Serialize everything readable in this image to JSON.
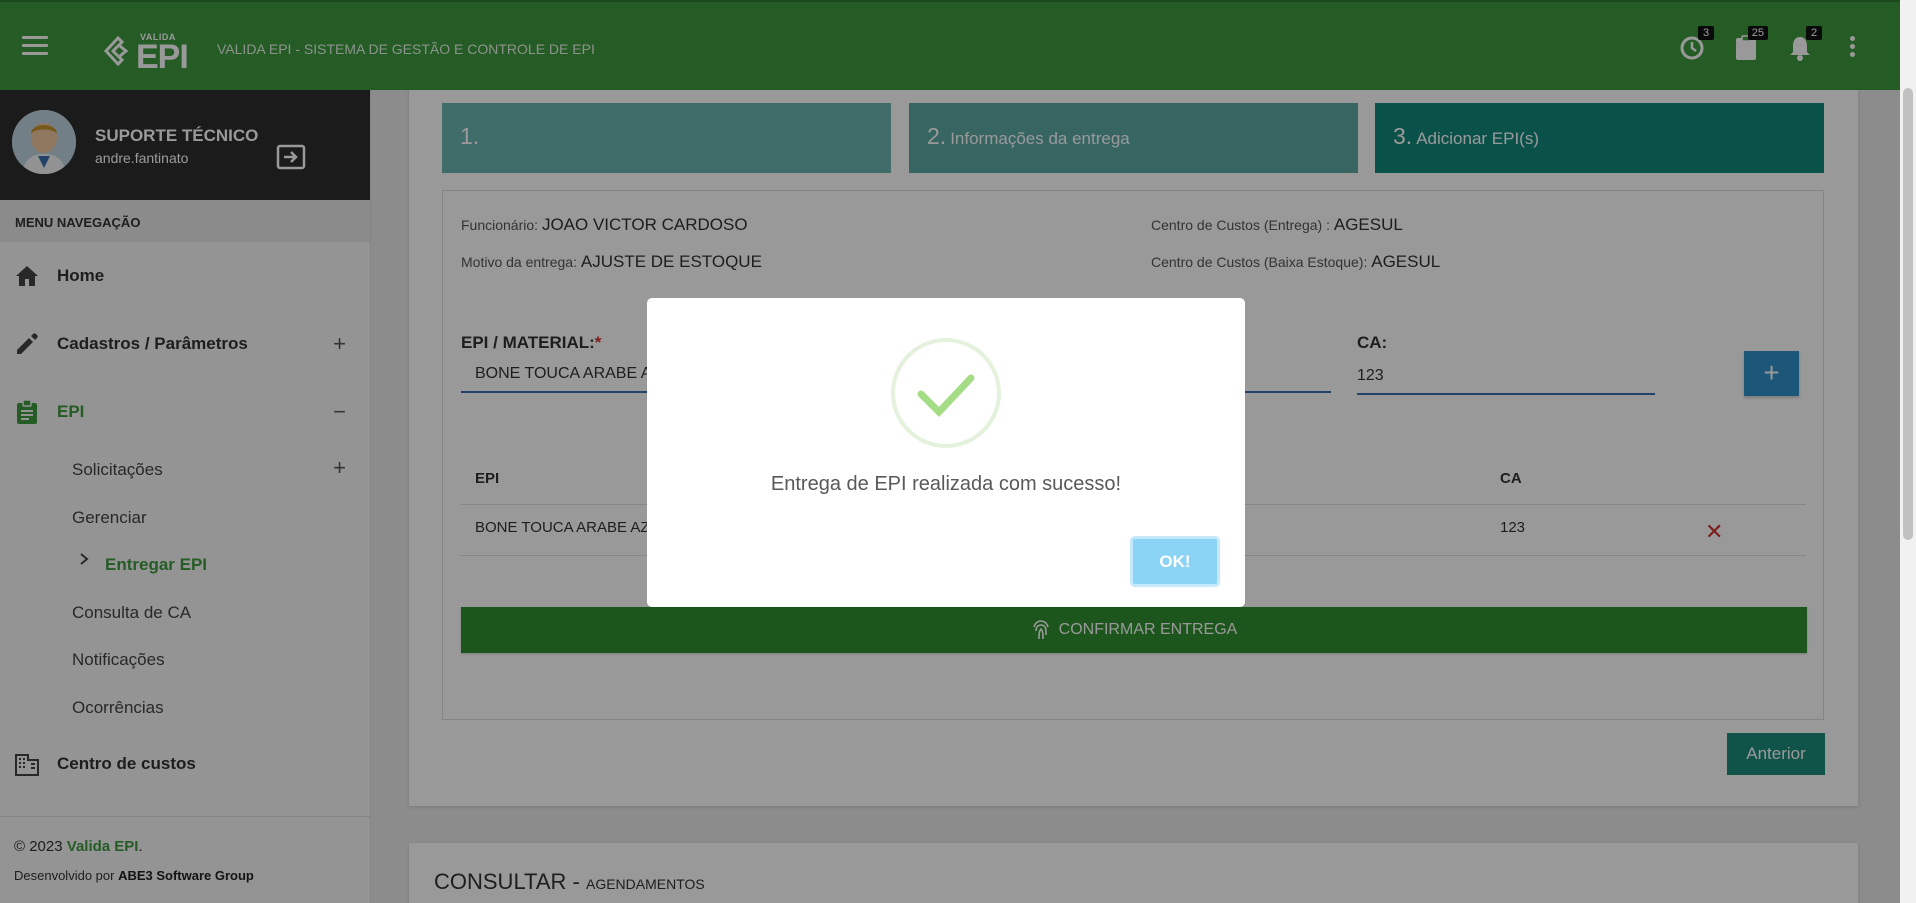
{
  "header": {
    "logo_small": "VALIDA",
    "logo_big": "EPI",
    "title": "VALIDA EPI - SISTEMA DE GESTÃO E CONTROLE DE EPI",
    "badges": {
      "history": "3",
      "tasks": "25",
      "notifications": "2"
    }
  },
  "user": {
    "name": "SUPORTE TÉCNICO",
    "login": "andre.fantinato"
  },
  "sidebar": {
    "menu_header": "MENU NAVEGAÇÃO",
    "items": [
      {
        "label": "Home"
      },
      {
        "label": "Cadastros / Parâmetros",
        "toggle": "+"
      },
      {
        "label": "EPI",
        "toggle": "−"
      },
      {
        "label": "Centro de custos"
      }
    ],
    "epi_subitems": [
      {
        "label": "Solicitações",
        "toggle": "+"
      },
      {
        "label": "Gerenciar"
      },
      {
        "label": "Entregar EPI"
      },
      {
        "label": "Consulta de CA"
      },
      {
        "label": "Notificações"
      },
      {
        "label": "Ocorrências"
      }
    ],
    "footer": {
      "copy_prefix": "© 2023 ",
      "brand": "Valida EPI",
      "copy_suffix": ".",
      "dev_prefix": "Desenvolvido por ",
      "dev_company": "ABE3 Software Group"
    }
  },
  "steps": [
    {
      "num": "1.",
      "label": ""
    },
    {
      "num": "2.",
      "label": "Informações da entrega"
    },
    {
      "num": "3.",
      "label": "Adicionar EPI(s)"
    }
  ],
  "delivery_info": {
    "employee_label": "Funcionário: ",
    "employee": "JOAO VICTOR CARDOSO",
    "reason_label": "Motivo da entrega: ",
    "reason": "AJUSTE DE ESTOQUE",
    "cc_delivery_label": "Centro de Custos (Entrega) : ",
    "cc_delivery": "AGESUL",
    "cc_stock_label": "Centro de Custos (Baixa Estoque): ",
    "cc_stock": "AGESUL"
  },
  "form": {
    "epi_label": "EPI / MATERIAL:",
    "required_mark": "*",
    "epi_value": "BONE TOUCA ARABE AZ",
    "ca_label": "CA:",
    "ca_value": "123",
    "add_label": "+"
  },
  "table": {
    "headers": [
      "EPI",
      "CA"
    ],
    "rows": [
      {
        "epi": "BONE TOUCA ARABE AZU",
        "ca": "123",
        "remove": "✕"
      }
    ]
  },
  "buttons": {
    "confirm": "CONFIRMAR ENTREGA",
    "previous": "Anterior"
  },
  "consult": {
    "title": "CONSULTAR - ",
    "subtitle": "AGENDAMENTOS"
  },
  "modal": {
    "message": "Entrega de EPI realizada com sucesso!",
    "ok": "OK!"
  },
  "colors": {
    "topbar": "#3f9a40",
    "step1": "#6cb5b0",
    "step2": "#5aa9a3",
    "step3": "#11897a",
    "confirm": "#2f8f2f",
    "success": "#a5dc86",
    "ok_button": "#8cd4f5"
  }
}
